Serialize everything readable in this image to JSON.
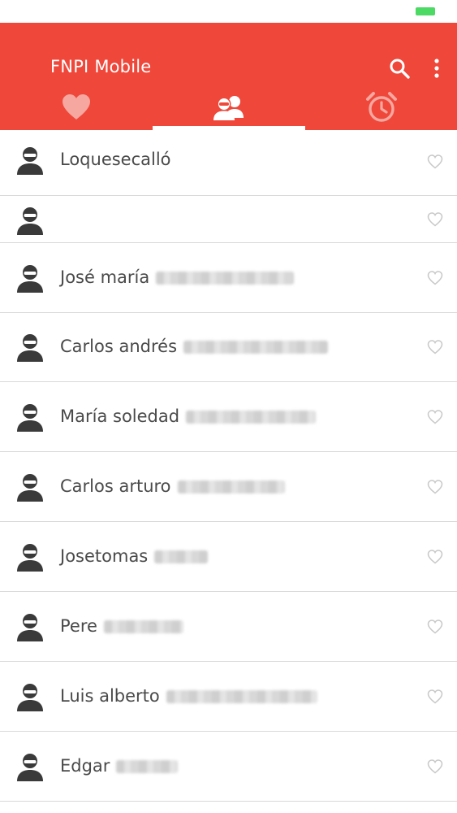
{
  "app": {
    "title": "FNPI Mobile"
  },
  "colors": {
    "app_bar": "#ef473a",
    "tab_inactive_icon": "#f6a79f",
    "battery": "#4cd964",
    "avatar": "#3a3a3a",
    "heart_outline": "#c8c8c8"
  },
  "actions": [
    {
      "icon": "search-icon"
    },
    {
      "icon": "more-vertical-icon"
    }
  ],
  "tabs": [
    {
      "icon": "heart-icon",
      "selected": false
    },
    {
      "icon": "contacts-icon",
      "selected": true
    },
    {
      "icon": "alarm-clock-icon",
      "selected": false
    }
  ],
  "contacts": [
    {
      "name": "Loquesecalló"
    },
    {
      "name": ""
    },
    {
      "name": "José maría"
    },
    {
      "name": "Carlos andrés"
    },
    {
      "name": "María soledad"
    },
    {
      "name": "Carlos arturo"
    },
    {
      "name": "Josetomas"
    },
    {
      "name": "Pere"
    },
    {
      "name": "Luis alberto"
    },
    {
      "name": "Edgar"
    }
  ]
}
